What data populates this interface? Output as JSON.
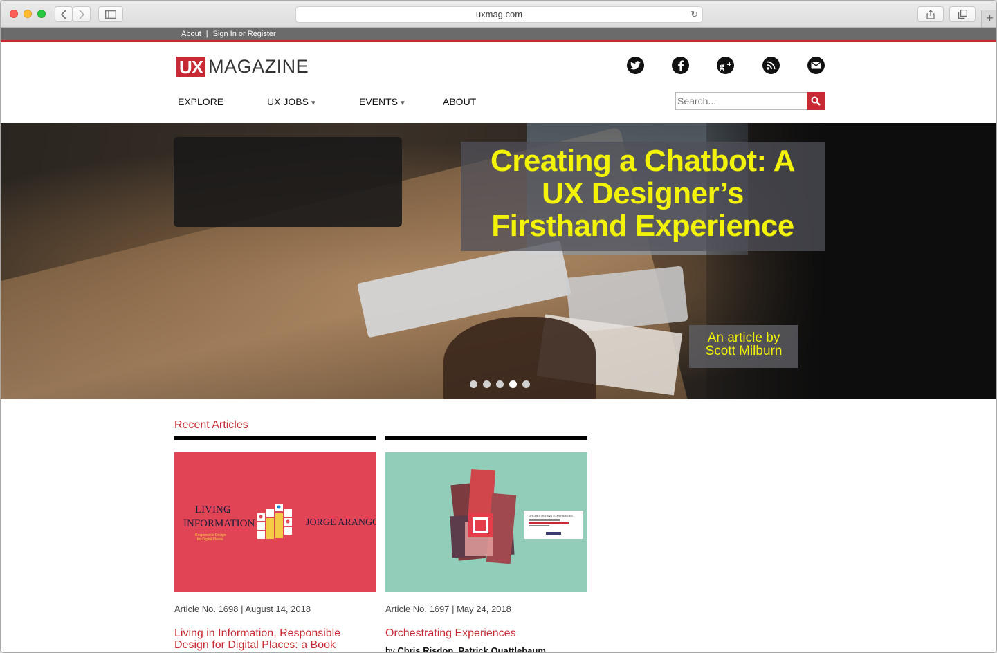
{
  "browser": {
    "url": "uxmag.com"
  },
  "topbar": {
    "about": "About",
    "separator": "|",
    "signin": "Sign In or Register"
  },
  "logo": {
    "ux": "UX",
    "magazine": "MAGAZINE"
  },
  "social": {
    "twitter": "twitter-icon",
    "facebook": "facebook-icon",
    "googleplus": "google-plus-icon",
    "rss": "rss-icon",
    "email": "email-icon"
  },
  "nav": {
    "explore": "EXPLORE",
    "jobs": "UX JOBS",
    "events": "EVENTS",
    "about": "ABOUT",
    "caret": "▼"
  },
  "search": {
    "placeholder": "Search..."
  },
  "hero": {
    "headline_line1": "Creating a Chatbot: A",
    "headline_line2": "UX Designer’s",
    "headline_line3": "Firsthand Experience",
    "byline_line1": "An article by",
    "byline_line2": "Scott Milburn",
    "slide_count": 5,
    "active_slide": 4
  },
  "recent": {
    "heading": "Recent Articles",
    "articles": [
      {
        "meta": "Article No. 1698 | August 14, 2018",
        "title_line1": "Living in Information, Responsible",
        "title_line2": "Design for Digital Places: a Book",
        "cover": {
          "left_title1": "LIVING",
          "left_title2": "in",
          "left_title3": "INFORMATION",
          "left_sub1": "Responsible Design",
          "left_sub2": "for Digital Places",
          "right_name": "JORGE ARANGO"
        }
      },
      {
        "meta": "Article No. 1697 | May 24, 2018",
        "title_line1": "Orchestrating Experiences",
        "author_prefix": "by",
        "author_names": "Chris Risdon, Patrick Quattlebaum",
        "cover": {
          "card_title": "ORCHESTRATING EXPERIENCES"
        }
      }
    ]
  },
  "colors": {
    "brand_red": "#c72a34",
    "headline_yellow": "#f2f20a"
  }
}
